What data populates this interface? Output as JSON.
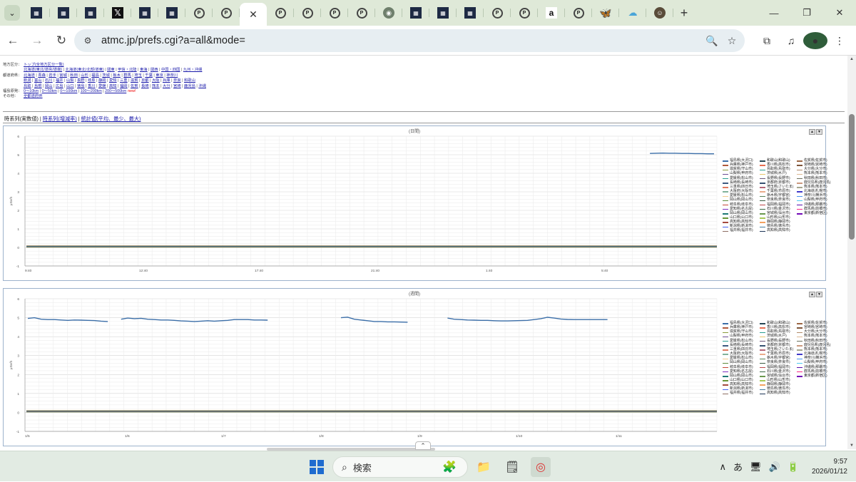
{
  "browser": {
    "tab_icons": [
      "grid-icon",
      "grid-icon",
      "grid-icon",
      "x-icon",
      "grid-icon",
      "grid-icon",
      "p-icon",
      "p-icon",
      "active-tab",
      "p-icon",
      "p-icon",
      "p-icon",
      "p-icon",
      "globe-icon",
      "grid-icon",
      "grid-icon",
      "grid-icon",
      "p-icon",
      "p-icon",
      "amazon-icon",
      "p-icon",
      "butterfly-icon",
      "cloud-icon",
      "account-icon"
    ],
    "tab_glyphs": {
      "grid-icon": "▦",
      "x-icon": "𝕏",
      "p-icon": "P",
      "globe-icon": "◉",
      "amazon-icon": "a",
      "butterfly-icon": "🦋",
      "cloud-icon": "☁",
      "account-icon": "☺"
    },
    "close_glyph": "✕",
    "new_tab": "+",
    "dropdown": "⌄",
    "back": "←",
    "forward": "→",
    "reload": "↻",
    "site_info": "⚙",
    "url": "atmc.jp/prefs.cgi?a=all&mode=",
    "zoom_icon": "🔍",
    "star_icon": "☆",
    "extensions_icon": "⧉",
    "media_icon": "♫",
    "profile_initial": "●",
    "menu_icon": "⋮",
    "win_min": "—",
    "win_max": "❐",
    "win_close": "✕"
  },
  "page": {
    "nav_rows": [
      {
        "label": "地方区分：",
        "links": [
          "トップ(全地方区分一覧)"
        ]
      },
      {
        "label": "",
        "links": [
          "北海道(東北/道央/道南)",
          "北海道(東北/北部/道東)",
          "関東",
          "甲信・北陸",
          "東海",
          "関西",
          "中国・四国",
          "九州・沖縄"
        ]
      },
      {
        "label": "都道府県：",
        "links": [
          "北海道",
          "青森",
          "岩手",
          "宮城",
          "秋田",
          "山形",
          "福島",
          "茨城",
          "栃木",
          "群馬",
          "埼玉",
          "千葉",
          "東京",
          "神奈川"
        ]
      },
      {
        "label": "",
        "links": [
          "新潟",
          "富山",
          "石川",
          "福井",
          "山梨",
          "長野",
          "岐阜",
          "静岡",
          "愛知",
          "三重",
          "滋賀",
          "京都",
          "大阪",
          "兵庫",
          "奈良",
          "和歌山"
        ]
      },
      {
        "label": "",
        "links": [
          "鳥取",
          "島根",
          "岡山",
          "広島",
          "山口",
          "徳島",
          "香川",
          "愛媛",
          "高知",
          "福岡",
          "佐賀",
          "長崎",
          "熊本",
          "大分",
          "宮崎",
          "鹿児島",
          "沖縄"
        ]
      },
      {
        "label": "福島原発：",
        "links": [
          "0〜10km",
          "0〜50km",
          "0〜100km",
          "100〜200km",
          "200〜500km"
        ],
        "suffix": "new!"
      },
      {
        "label": "その他：",
        "links": [
          "全都道府県"
        ]
      }
    ],
    "view_tabs": {
      "current": "時系列(実数値)",
      "sep": " | ",
      "links": [
        "時系列(増減率)",
        "統計値(平均、最少、最大)"
      ]
    }
  },
  "chart_data": [
    {
      "type": "line",
      "title": "(日間)",
      "ylabel": "μSv/h",
      "ylim": [
        -1,
        6
      ],
      "yticks": [
        "-1",
        "0",
        "1",
        "2",
        "3",
        "4",
        "5",
        "6"
      ],
      "xticks": [
        "9:40",
        "12:40",
        "17:40",
        "21:40",
        "1:40",
        "5:40"
      ],
      "series": [
        {
          "name": "福島県(双葉)",
          "color": "#3b6ea8",
          "values": [
            null,
            null,
            null,
            null,
            null,
            null,
            null,
            null,
            null,
            null,
            null,
            null,
            null,
            null,
            null,
            null,
            null,
            null,
            null,
            null,
            null,
            null,
            null,
            null,
            null,
            null,
            null,
            null,
            null,
            null,
            null,
            null,
            null,
            null,
            null,
            null,
            null,
            null,
            null,
            null,
            null,
            null,
            null,
            null,
            null,
            null,
            null,
            null,
            null,
            null,
            null,
            null,
            null,
            null,
            null,
            null,
            null,
            null,
            null,
            null,
            null,
            null,
            null,
            null,
            null,
            null,
            null,
            null,
            null,
            null,
            null,
            null,
            null,
            null,
            null,
            null,
            null,
            null,
            null,
            null,
            null,
            null,
            null,
            null,
            null,
            null,
            null,
            null,
            null,
            null,
            null,
            null,
            null,
            null,
            null,
            null,
            null,
            5.07,
            5.08,
            5.09,
            5.08,
            5.08,
            5.07,
            5.07,
            5.06,
            5.06,
            5.05,
            5.05
          ]
        },
        {
          "name": "その他地点(ほぼ0)",
          "color": "#b05a3c",
          "values": [
            0.05
          ]
        }
      ]
    },
    {
      "type": "line",
      "title": "(週間)",
      "ylabel": "μSv/h",
      "ylim": [
        -1,
        6
      ],
      "yticks": [
        "-1",
        "0",
        "1",
        "2",
        "3",
        "4",
        "5",
        "6"
      ],
      "xticks": [
        "1/5",
        "1/6",
        "1/7",
        "1/8",
        "1/9",
        "1/10",
        "1/11"
      ],
      "series": [
        {
          "name": "福島県(双葉)",
          "color": "#3b6ea8",
          "values": [
            4.96,
            5.0,
            4.92,
            4.9,
            4.9,
            4.88,
            4.86,
            4.88,
            4.87,
            4.86,
            4.85,
            4.82,
            4.8,
            null,
            4.92,
            4.98,
            4.95,
            4.97,
            4.92,
            4.9,
            4.88,
            4.88,
            4.86,
            4.83,
            4.82,
            4.8,
            4.82,
            4.84,
            4.82,
            4.84,
            4.86,
            4.9,
            4.9,
            4.9,
            4.88,
            4.88,
            4.87,
            null,
            null,
            null,
            null,
            null,
            null,
            null,
            null,
            null,
            null,
            5.0,
            5.03,
            4.92,
            4.88,
            4.84,
            4.8,
            4.8,
            4.78,
            4.78,
            4.77,
            4.76,
            null,
            null,
            null,
            null,
            null,
            4.98,
            4.92,
            4.9,
            4.88,
            4.87,
            4.86,
            4.86,
            4.84,
            4.83,
            4.83,
            4.84,
            4.85,
            4.86,
            4.9,
            4.95,
            5.02,
            4.98,
            4.93,
            4.91,
            4.9,
            4.9,
            4.9,
            4.9,
            4.9,
            4.9,
            null,
            null,
            null,
            null,
            null,
            null,
            null,
            null,
            null,
            null,
            null,
            null,
            null,
            null,
            null,
            5.05
          ]
        },
        {
          "name": "その他地点(ほぼ0)",
          "color": "#b05a3c",
          "values": [
            0.06
          ]
        }
      ]
    }
  ],
  "legend": {
    "col1": [
      "福島県(大沢口)",
      "兵庫県(神戸市)",
      "滋賀県(守山市)",
      "山梨県(甲府市)",
      "愛媛県(松山市)",
      "長崎県(長崎市)",
      "三重県(四日市)",
      "大阪府(大阪市)",
      "愛媛県(松山市)",
      "岡山県(岡山市)",
      "岐阜県(岐阜市)",
      "愛知県(名古屋)",
      "岡山県(岡山市)",
      "山口県(山口市)",
      "高知県(高知市)",
      "新潟県(新潟市)",
      "福井県(福井市)"
    ],
    "col2": [
      "和歌山(和歌山)",
      "香川県(高松市)",
      "鳥取県(鳥取市)",
      "茨城県(水戸)",
      "長野県(長野市)",
      "京都府(京都市)",
      "埼玉県(さいたま)",
      "千葉県(市原市)",
      "栃木県(宇都宮)",
      "奈良県(奈良市)",
      "福岡県(福岡市)",
      "石川県(金沢市)",
      "宮城県(仙台市)",
      "山形県(山形市)",
      "静岡県(静岡市)",
      "徳島県(徳島市)",
      "高知県(高知市)"
    ],
    "col3": [
      "佐賀県(佐賀市)",
      "宮崎県(宮崎市)",
      "大分県(大分市)",
      "熊本県(熊本市)",
      "秋田県(秋田市)",
      "鹿児島県(鹿児島)",
      "熊本県(熊本市)",
      "北海道(札幌市)",
      "神奈川(横浜市)",
      "山梨県(甲府市)",
      "沖縄県(那覇市)",
      "群馬県(前橋市)",
      "東京都(新宿区)"
    ],
    "col1_colors": [
      "#3b6ea8",
      "#b05a3c",
      "#8a9a3b",
      "#6a4c93",
      "#2a9d8f",
      "#3d5a80",
      "#e07a5f",
      "#81b29a",
      "#f2cc8f",
      "#5c8a3b",
      "#c44536",
      "#7b2cbf",
      "#1d7874",
      "#679436",
      "#a44a3f",
      "#4361ee",
      "#8d6e63"
    ],
    "col2_colors": [
      "#264653",
      "#e76f51",
      "#2a9d8f",
      "#e9c46a",
      "#6d597a",
      "#355070",
      "#b56576",
      "#eaac8b",
      "#588157",
      "#3a5a40",
      "#bc4749",
      "#386641",
      "#6a994e",
      "#a7c957",
      "#f4a261",
      "#457b9d",
      "#1d3557"
    ],
    "col3_colors": [
      "#9c6644",
      "#7f5539",
      "#b08968",
      "#ddb892",
      "#6b705c",
      "#cb997e",
      "#a5a58d",
      "#3f37c9",
      "#4895ef",
      "#4cc9f0",
      "#560bad",
      "#f72585",
      "#7209b7"
    ]
  },
  "taskbar": {
    "search_placeholder": "検索",
    "search_icon": "⌕",
    "apps": [
      "🧩",
      "📁",
      "🗒",
      "◎"
    ],
    "tray_chevron": "∧",
    "ime": "あ",
    "network_icon": "🖥",
    "volume_icon": "🔊",
    "battery_icon": "🔋",
    "time": "9:57",
    "date": "2026/01/12"
  }
}
